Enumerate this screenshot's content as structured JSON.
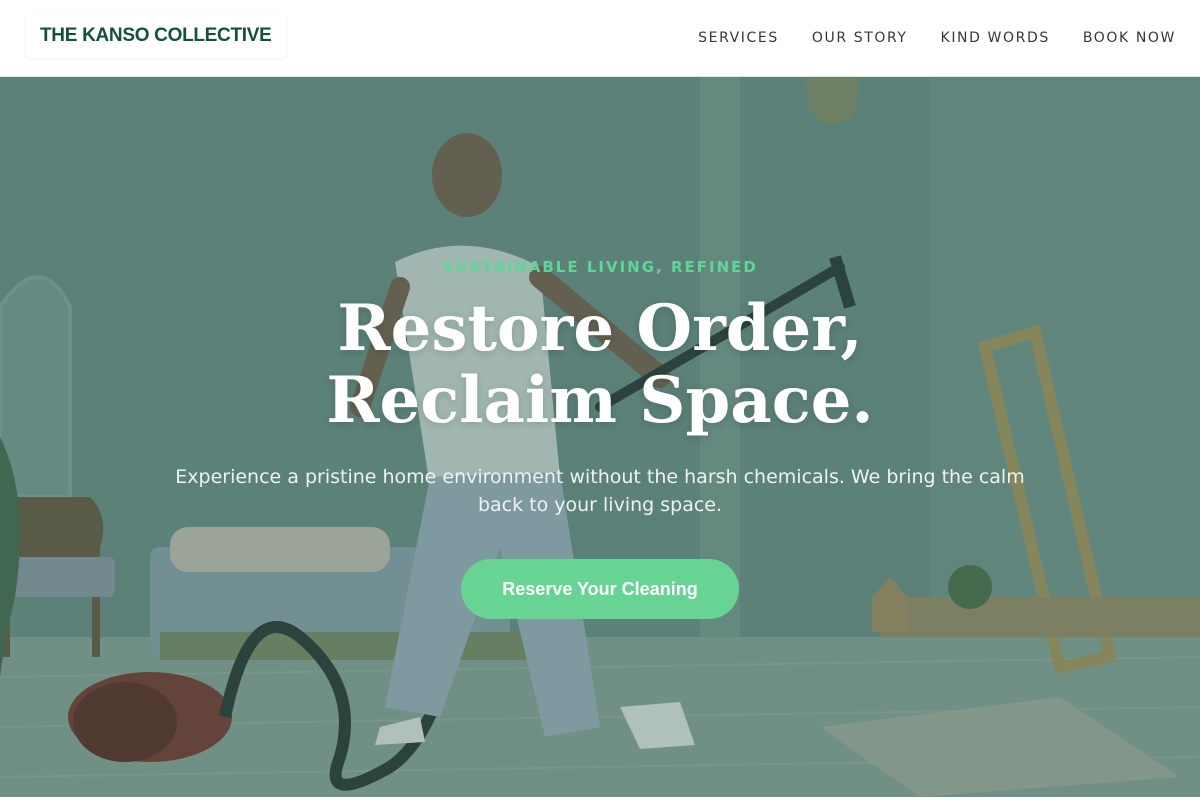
{
  "brand": {
    "name": "THE KANSO COLLECTIVE"
  },
  "nav": {
    "items": [
      {
        "label": "SERVICES"
      },
      {
        "label": "OUR STORY"
      },
      {
        "label": "KIND WORDS"
      },
      {
        "label": "BOOK NOW"
      }
    ]
  },
  "hero": {
    "eyebrow": "SUSTAINABLE LIVING, REFINED",
    "headline": "Restore Order, Reclaim Space.",
    "subtext": "Experience a pristine home environment without the harsh chemicals. We bring the calm back to your living space.",
    "cta_label": "Reserve Your Cleaning",
    "background_image": "photo of a man vacuuming a bright room"
  },
  "colors": {
    "brand_green": "#14503a",
    "accent_green": "#67d494",
    "eyebrow_green": "#5fd59a",
    "hero_tint": "#5d7a71"
  }
}
